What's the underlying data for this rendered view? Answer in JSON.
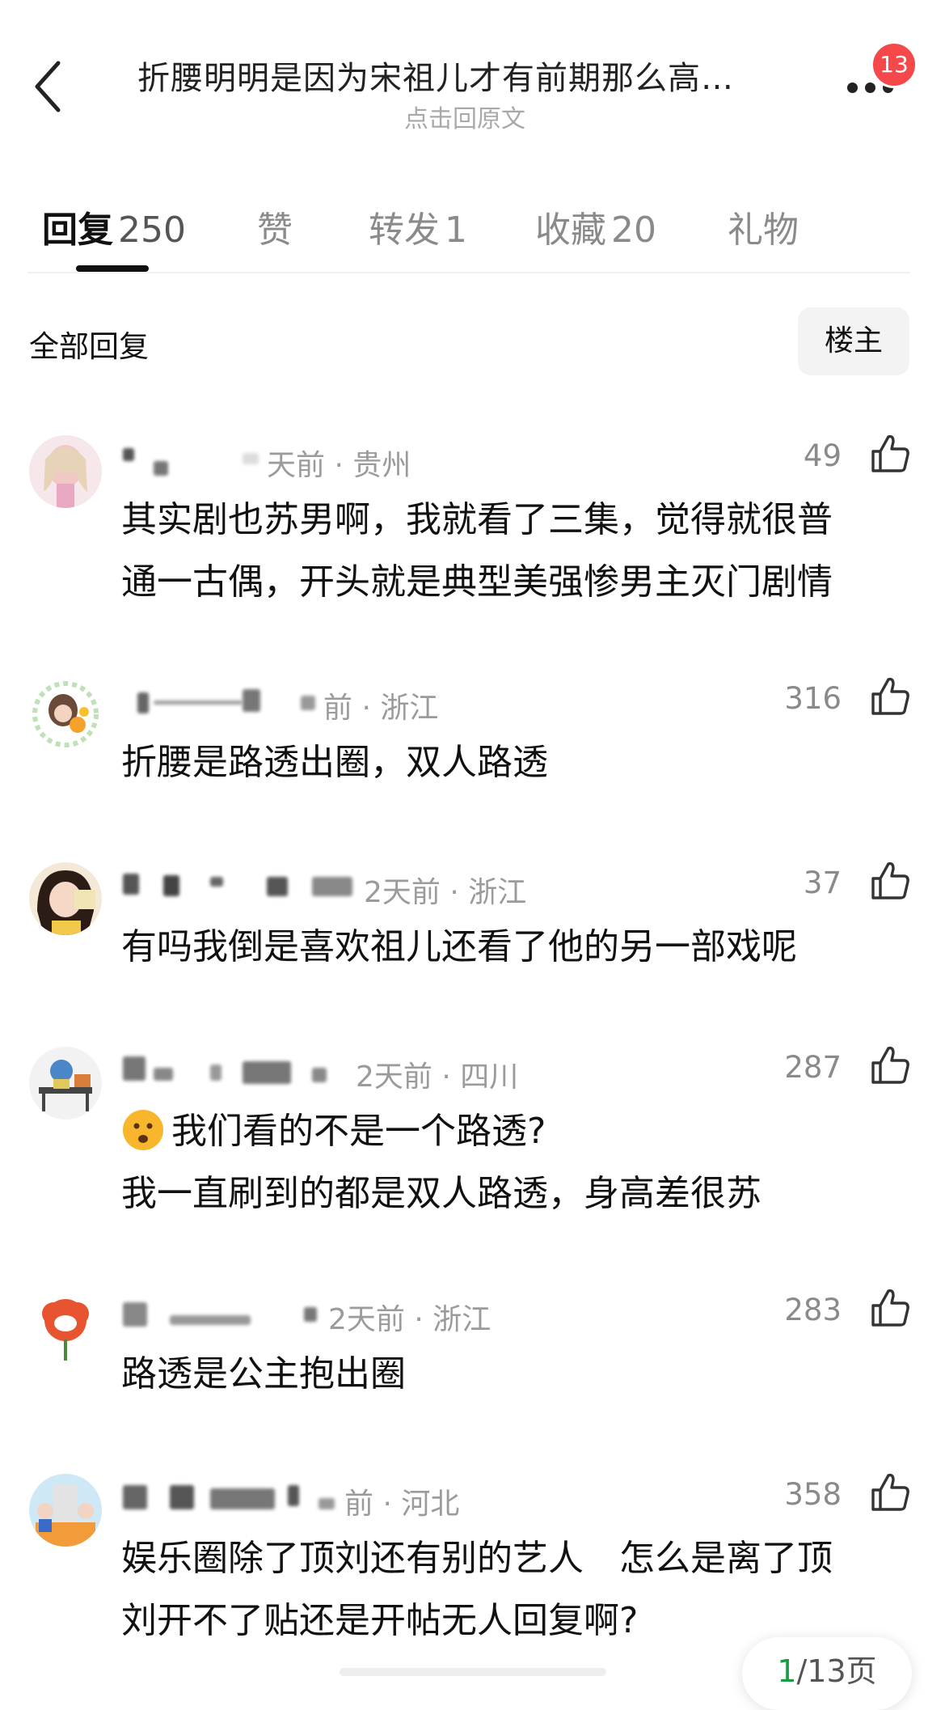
{
  "header": {
    "title": "折腰明明是因为宋祖儿才有前期那么高…",
    "subtitle": "点击回原文",
    "badge": "13"
  },
  "tabs": [
    {
      "label": "回复",
      "count": "250",
      "active": true
    },
    {
      "label": "赞",
      "count": "",
      "active": false
    },
    {
      "label": "转发",
      "count": "1",
      "active": false
    },
    {
      "label": "收藏",
      "count": "20",
      "active": false
    },
    {
      "label": "礼物",
      "count": "",
      "active": false
    }
  ],
  "section": {
    "title": "全部回复",
    "filter_button": "楼主"
  },
  "comments": [
    {
      "time_location": "天前 · 贵州",
      "likes": "49",
      "text": [
        "其实剧也苏男啊，我就看了三集，觉得就很普",
        "通一古偶，开头就是典型美强惨男主灭门剧情"
      ]
    },
    {
      "time_location": "前 · 浙江",
      "likes": "316",
      "text": [
        "折腰是路透出圈，双人路透"
      ]
    },
    {
      "time_location": "2天前 · 浙江",
      "likes": "37",
      "text": [
        "有吗我倒是喜欢祖儿还看了他的另一部戏呢"
      ]
    },
    {
      "time_location": "2天前 · 四川",
      "likes": "287",
      "text": [
        "我们看的不是一个路透?",
        "我一直刷到的都是双人路透，身高差很苏"
      ]
    },
    {
      "time_location": "2天前 · 浙江",
      "likes": "283",
      "text": [
        "路透是公主抱出圈"
      ]
    },
    {
      "time_location": "前 · 河北",
      "likes": "358",
      "text": [
        "娱乐圈除了顶刘还有别的艺人　怎么是离了顶",
        "刘开不了贴还是开帖无人回复啊?"
      ]
    }
  ],
  "pagination": {
    "current": "1",
    "total_label": "/13页"
  }
}
